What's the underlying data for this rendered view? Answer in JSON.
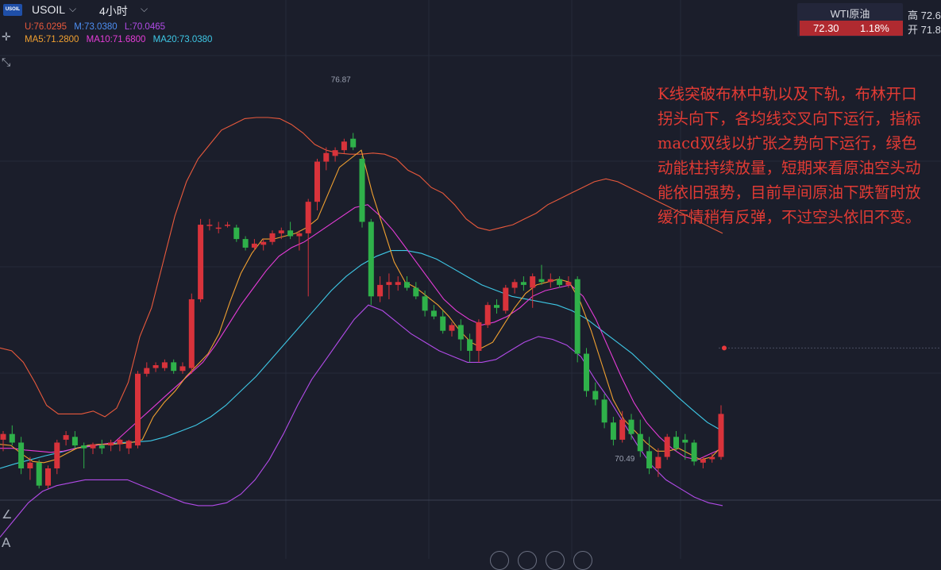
{
  "header": {
    "logo_text": "USOIL",
    "symbol": "USOIL",
    "period": "4小时",
    "dropdown_icon": "chevron-down-icon"
  },
  "bollinger": {
    "upper": "U:76.0295",
    "middle": "M:73.0380",
    "lower": "L:70.0465",
    "colors": {
      "upper": "#e8593c",
      "middle": "#4d8ef2",
      "lower": "#b24be8"
    }
  },
  "moving_averages": {
    "ma5": "MA5:71.2800",
    "ma10": "MA10:71.6800",
    "ma20": "MA20:73.0380",
    "colors": {
      "ma5": "#f0a030",
      "ma10": "#e63cd8",
      "ma20": "#3ec8e6"
    }
  },
  "ticker": {
    "name": "WTI原油",
    "price": "72.30",
    "change": "1.18%",
    "high_label": "高 72.6",
    "open_label": "开 71.8"
  },
  "price_labels": {
    "high_marker": "76.87",
    "low_marker": "70.49"
  },
  "annotation": {
    "text": "K线突破布林中轨以及下轨，布林开口拐头向下，各均线交叉向下运行，指标macd双线以扩张之势向下运行，绿色动能柱持续放量，短期来看原油空头动能依旧强势，目前早间原油下跌暂时放缓行情稍有反弹，不过空头依旧不变。"
  },
  "chart_data": {
    "type": "candlestick",
    "ohlc": [
      [
        70.7,
        70.85,
        70.5,
        70.8
      ],
      [
        70.8,
        70.95,
        70.6,
        70.65
      ],
      [
        70.65,
        70.75,
        70.1,
        70.2
      ],
      [
        70.2,
        70.4,
        70.0,
        70.3
      ],
      [
        70.3,
        70.35,
        69.85,
        69.9
      ],
      [
        69.9,
        70.25,
        69.85,
        70.2
      ],
      [
        70.2,
        70.7,
        70.1,
        70.65
      ],
      [
        70.7,
        70.85,
        70.6,
        70.78
      ],
      [
        70.75,
        70.85,
        70.55,
        70.6
      ],
      [
        70.6,
        70.65,
        70.2,
        70.55
      ],
      [
        70.55,
        70.65,
        70.45,
        70.62
      ],
      [
        70.6,
        70.7,
        70.45,
        70.55
      ],
      [
        70.6,
        70.7,
        70.5,
        70.65
      ],
      [
        70.62,
        70.72,
        70.5,
        70.7
      ],
      [
        70.55,
        70.7,
        70.45,
        70.68
      ],
      [
        70.6,
        71.9,
        70.55,
        71.85
      ],
      [
        71.85,
        72.05,
        71.8,
        71.95
      ],
      [
        71.95,
        72.05,
        71.88,
        72.0
      ],
      [
        71.95,
        72.1,
        71.9,
        72.05
      ],
      [
        72.05,
        72.1,
        71.85,
        71.9
      ],
      [
        71.9,
        72.05,
        71.85,
        71.98
      ],
      [
        71.95,
        73.25,
        71.85,
        73.15
      ],
      [
        73.15,
        74.55,
        73.1,
        74.45
      ],
      [
        74.45,
        74.55,
        74.35,
        74.45
      ],
      [
        74.4,
        74.5,
        74.3,
        74.4
      ],
      [
        74.45,
        74.5,
        74.4,
        74.45
      ],
      [
        74.4,
        74.45,
        74.15,
        74.2
      ],
      [
        74.2,
        74.25,
        74.0,
        74.05
      ],
      [
        74.05,
        74.2,
        74.0,
        74.12
      ],
      [
        74.1,
        74.2,
        74.0,
        74.15
      ],
      [
        74.15,
        74.35,
        74.1,
        74.3
      ],
      [
        74.3,
        74.4,
        74.2,
        74.35
      ],
      [
        74.35,
        74.5,
        74.2,
        74.25
      ],
      [
        74.25,
        74.35,
        74.0,
        74.3
      ],
      [
        74.3,
        74.9,
        73.2,
        74.85
      ],
      [
        74.85,
        75.6,
        74.7,
        75.55
      ],
      [
        75.55,
        75.8,
        75.4,
        75.7
      ],
      [
        75.65,
        75.8,
        75.55,
        75.75
      ],
      [
        75.75,
        75.95,
        75.7,
        75.9
      ],
      [
        75.95,
        76.05,
        75.75,
        75.8
      ],
      [
        75.6,
        75.65,
        74.4,
        74.5
      ],
      [
        74.5,
        74.55,
        73.05,
        73.2
      ],
      [
        73.2,
        73.55,
        73.1,
        73.4
      ],
      [
        73.4,
        73.6,
        73.15,
        73.45
      ],
      [
        73.4,
        73.55,
        73.3,
        73.45
      ],
      [
        73.45,
        73.55,
        73.3,
        73.35
      ],
      [
        73.35,
        73.45,
        73.15,
        73.2
      ],
      [
        73.2,
        73.3,
        72.85,
        72.95
      ],
      [
        72.95,
        73.05,
        72.8,
        72.85
      ],
      [
        72.85,
        72.95,
        72.55,
        72.6
      ],
      [
        72.6,
        72.75,
        72.5,
        72.7
      ],
      [
        72.7,
        72.8,
        72.25,
        72.45
      ],
      [
        72.45,
        72.55,
        72.05,
        72.25
      ],
      [
        72.25,
        72.8,
        72.05,
        72.75
      ],
      [
        72.7,
        73.1,
        72.65,
        73.05
      ],
      [
        73.05,
        73.15,
        72.9,
        73.0
      ],
      [
        72.95,
        73.4,
        72.9,
        73.35
      ],
      [
        73.35,
        73.5,
        73.25,
        73.45
      ],
      [
        73.45,
        73.55,
        73.3,
        73.4
      ],
      [
        73.35,
        73.6,
        73.0,
        73.55
      ],
      [
        73.5,
        73.75,
        73.4,
        73.45
      ],
      [
        73.45,
        73.6,
        73.35,
        73.5
      ],
      [
        73.5,
        73.55,
        73.35,
        73.4
      ],
      [
        73.4,
        73.55,
        73.35,
        73.45
      ],
      [
        73.5,
        73.55,
        72.05,
        72.2
      ],
      [
        72.2,
        72.3,
        71.45,
        71.55
      ],
      [
        71.55,
        71.7,
        71.3,
        71.4
      ],
      [
        71.4,
        71.5,
        70.9,
        71.0
      ],
      [
        71.0,
        71.1,
        70.6,
        70.7
      ],
      [
        70.7,
        71.2,
        70.65,
        71.05
      ],
      [
        71.05,
        71.15,
        70.7,
        70.8
      ],
      [
        70.8,
        71.05,
        70.4,
        70.5
      ],
      [
        70.5,
        70.75,
        70.1,
        70.2
      ],
      [
        70.2,
        70.55,
        70.05,
        70.4
      ],
      [
        70.4,
        70.8,
        70.35,
        70.75
      ],
      [
        70.75,
        70.85,
        70.5,
        70.55
      ],
      [
        70.7,
        70.8,
        70.35,
        70.65
      ],
      [
        70.65,
        70.7,
        70.25,
        70.32
      ],
      [
        70.3,
        70.4,
        70.2,
        70.36
      ],
      [
        70.36,
        70.45,
        70.3,
        70.4
      ],
      [
        70.4,
        71.3,
        70.35,
        71.15
      ]
    ],
    "upper_band": [
      72.3,
      72.25,
      72.05,
      71.7,
      71.3,
      71.15,
      71.15,
      71.15,
      71.2,
      71.1,
      71.25,
      71.7,
      72.5,
      73.0,
      73.8,
      74.6,
      75.2,
      75.6,
      75.85,
      76.1,
      76.2,
      76.3,
      76.32,
      76.32,
      76.3,
      76.2,
      76.05,
      75.85,
      75.75,
      75.7,
      75.68,
      75.68,
      75.7,
      75.68,
      75.6,
      75.4,
      75.3,
      75.1,
      75.0,
      74.8,
      74.55,
      74.4,
      74.35,
      74.4,
      74.45,
      74.55,
      74.65,
      74.8,
      74.9,
      75.0,
      75.1,
      75.2,
      75.25,
      75.2,
      75.1,
      75.0,
      74.9,
      74.8,
      74.7,
      74.6,
      74.5,
      74.4,
      74.3
    ],
    "lower_band": [
      69.0,
      69.3,
      69.6,
      69.8,
      69.9,
      69.95,
      70.0,
      70.0,
      70.0,
      70.0,
      69.9,
      69.8,
      69.7,
      69.6,
      69.55,
      69.55,
      69.6,
      69.75,
      70.0,
      70.35,
      70.8,
      71.3,
      71.75,
      72.1,
      72.45,
      72.8,
      73.05,
      72.95,
      72.75,
      72.55,
      72.4,
      72.25,
      72.15,
      72.05,
      72.05,
      72.1,
      72.25,
      72.4,
      72.5,
      72.45,
      72.35,
      72.15,
      71.75,
      71.4,
      71.0,
      70.6,
      70.25,
      70.0,
      69.85,
      69.7,
      69.6,
      69.55
    ],
    "ma5": [
      70.62,
      70.6,
      70.45,
      70.32,
      70.3,
      70.35,
      70.45,
      70.55,
      70.6,
      70.62,
      70.62,
      70.63,
      70.65,
      70.7,
      71.1,
      71.35,
      71.55,
      71.8,
      72.0,
      72.2,
      72.55,
      73.1,
      73.6,
      73.95,
      74.2,
      74.2,
      74.25,
      74.3,
      74.4,
      74.55,
      75.0,
      75.45,
      75.6,
      75.75,
      75.0,
      74.4,
      73.8,
      73.45,
      73.35,
      73.2,
      73.05,
      72.85,
      72.6,
      72.4,
      72.3,
      72.4,
      72.7,
      73.0,
      73.25,
      73.4,
      73.45,
      73.5,
      73.45,
      73.1,
      72.6,
      72.0,
      71.4,
      71.05,
      70.85,
      70.65,
      70.5,
      70.5,
      70.55,
      70.45,
      70.35,
      70.4,
      70.6
    ],
    "ma10": [
      70.55,
      70.55,
      70.52,
      70.5,
      70.48,
      70.5,
      70.55,
      70.58,
      70.62,
      70.65,
      70.85,
      71.05,
      71.25,
      71.45,
      71.65,
      71.85,
      72.05,
      72.35,
      72.7,
      73.05,
      73.35,
      73.65,
      73.9,
      74.05,
      74.15,
      74.3,
      74.45,
      74.6,
      74.75,
      74.8,
      74.6,
      74.35,
      74.05,
      73.75,
      73.45,
      73.15,
      72.95,
      72.8,
      72.7,
      72.75,
      72.85,
      73.0,
      73.2,
      73.3,
      73.35,
      73.4,
      73.2,
      72.8,
      72.3,
      71.8,
      71.35,
      71.0,
      70.75,
      70.55,
      70.4,
      70.35,
      70.45,
      70.55
    ],
    "ma20": [
      70.2,
      70.28,
      70.35,
      70.42,
      70.48,
      70.55,
      70.6,
      70.62,
      70.65,
      70.66,
      70.68,
      70.75,
      70.85,
      70.95,
      71.1,
      71.3,
      71.55,
      71.8,
      72.1,
      72.4,
      72.7,
      73.0,
      73.3,
      73.55,
      73.75,
      73.9,
      74.0,
      74.0,
      73.95,
      73.85,
      73.7,
      73.55,
      73.4,
      73.3,
      73.2,
      73.15,
      73.1,
      73.05,
      72.95,
      72.8,
      72.6,
      72.4,
      72.2,
      71.95,
      71.7,
      71.45,
      71.22,
      71.0,
      70.85
    ],
    "price_axis": {
      "min": 69.3,
      "max": 77.4
    },
    "high": 76.87,
    "low": 70.49,
    "last": 72.3
  }
}
